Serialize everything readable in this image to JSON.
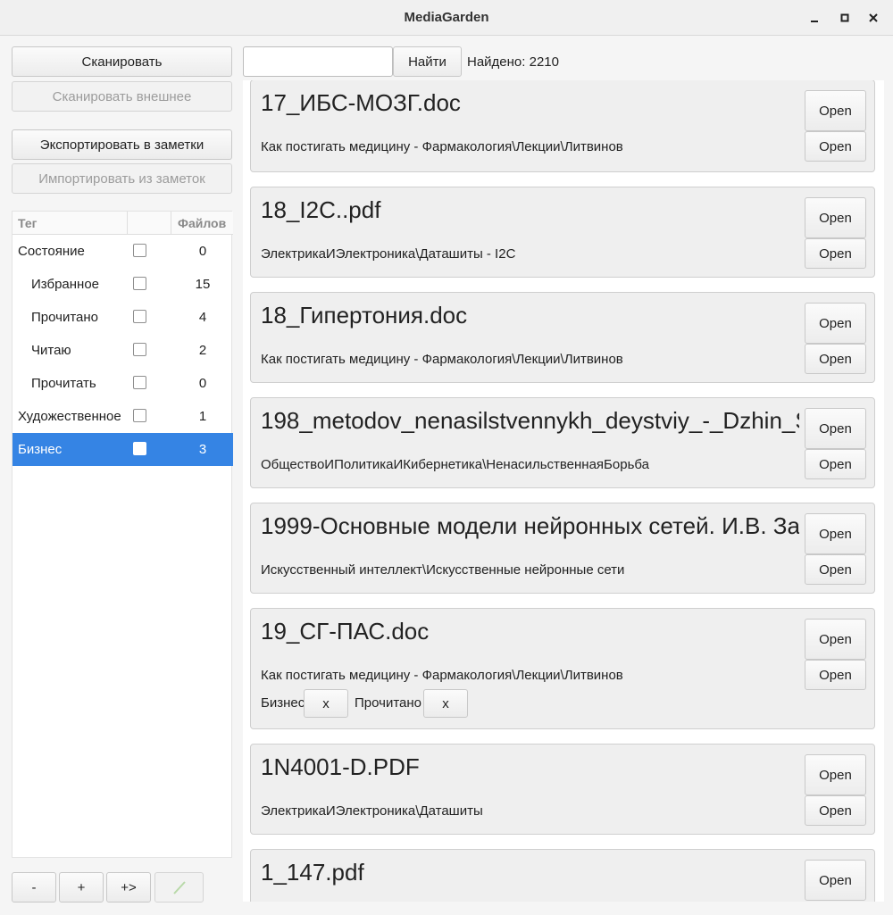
{
  "window": {
    "title": "MediaGarden"
  },
  "sidebar": {
    "scan_label": "Сканировать",
    "scan_external_label": "Сканировать внешнее",
    "export_label": "Экспортировать в заметки",
    "import_label": "Импортировать из заметок",
    "tag_table": {
      "columns": [
        "Тег",
        "",
        "Файлов"
      ],
      "rows": [
        {
          "name": "Состояние",
          "checked": false,
          "count": "0"
        },
        {
          "name": "Избранное",
          "checked": false,
          "count": "15"
        },
        {
          "name": "Прочитано",
          "checked": false,
          "count": "4"
        },
        {
          "name": "Читаю",
          "checked": false,
          "count": "2"
        },
        {
          "name": "Прочитать",
          "checked": false,
          "count": "0"
        },
        {
          "name": "Художественное",
          "checked": false,
          "count": "1"
        },
        {
          "name": "Бизнес",
          "checked": false,
          "count": "3",
          "selected": true
        }
      ]
    },
    "bottom_buttons": {
      "remove": "-",
      "add": "+",
      "add_child": "+>"
    }
  },
  "search": {
    "value": "",
    "find_label": "Найти",
    "found_text": "Найдено: 2210"
  },
  "files": [
    {
      "title": "17_ИБС-МОЗГ.doc",
      "path": "Как постигать медицину - Фармакология\\Лекции\\Литвинов",
      "open1": "Open",
      "open2": "Open"
    },
    {
      "title": "18_I2C..pdf",
      "path": "ЭлектрикаИЭлектроника\\Даташиты - I2C",
      "open1": "Open",
      "open2": "Open"
    },
    {
      "title": "18_Гипертония.doc",
      "path": "Как постигать медицину - Фармакология\\Лекции\\Литвинов",
      "open1": "Open",
      "open2": "Open"
    },
    {
      "title": "198_metodov_nenasilstvennykh_deystviy_-_Dzhin_S",
      "path": "ОбществоИПолитикаИКибернетика\\НенасильственнаяБорьба",
      "open1": "Open",
      "open2": "Open"
    },
    {
      "title": "1999-Основные модели нейронных сетей. И.В. За",
      "path": "Искусственный интеллект\\Искусственные нейронные сети",
      "open1": "Open",
      "open2": "Open"
    },
    {
      "title": "19_СГ-ПАС.doc",
      "path": "Как постигать медицину - Фармакология\\Лекции\\Литвинов",
      "open1": "Open",
      "open2": "Open",
      "tags": [
        {
          "name": "Бизнес",
          "remove": "x"
        },
        {
          "name": "Прочитано",
          "remove": "x"
        }
      ]
    },
    {
      "title": "1N4001-D.PDF",
      "path": "ЭлектрикаИЭлектроника\\Даташиты",
      "open1": "Open",
      "open2": "Open"
    },
    {
      "title": "1_147.pdf",
      "path": "",
      "open1": "Open",
      "open2": ""
    }
  ]
}
